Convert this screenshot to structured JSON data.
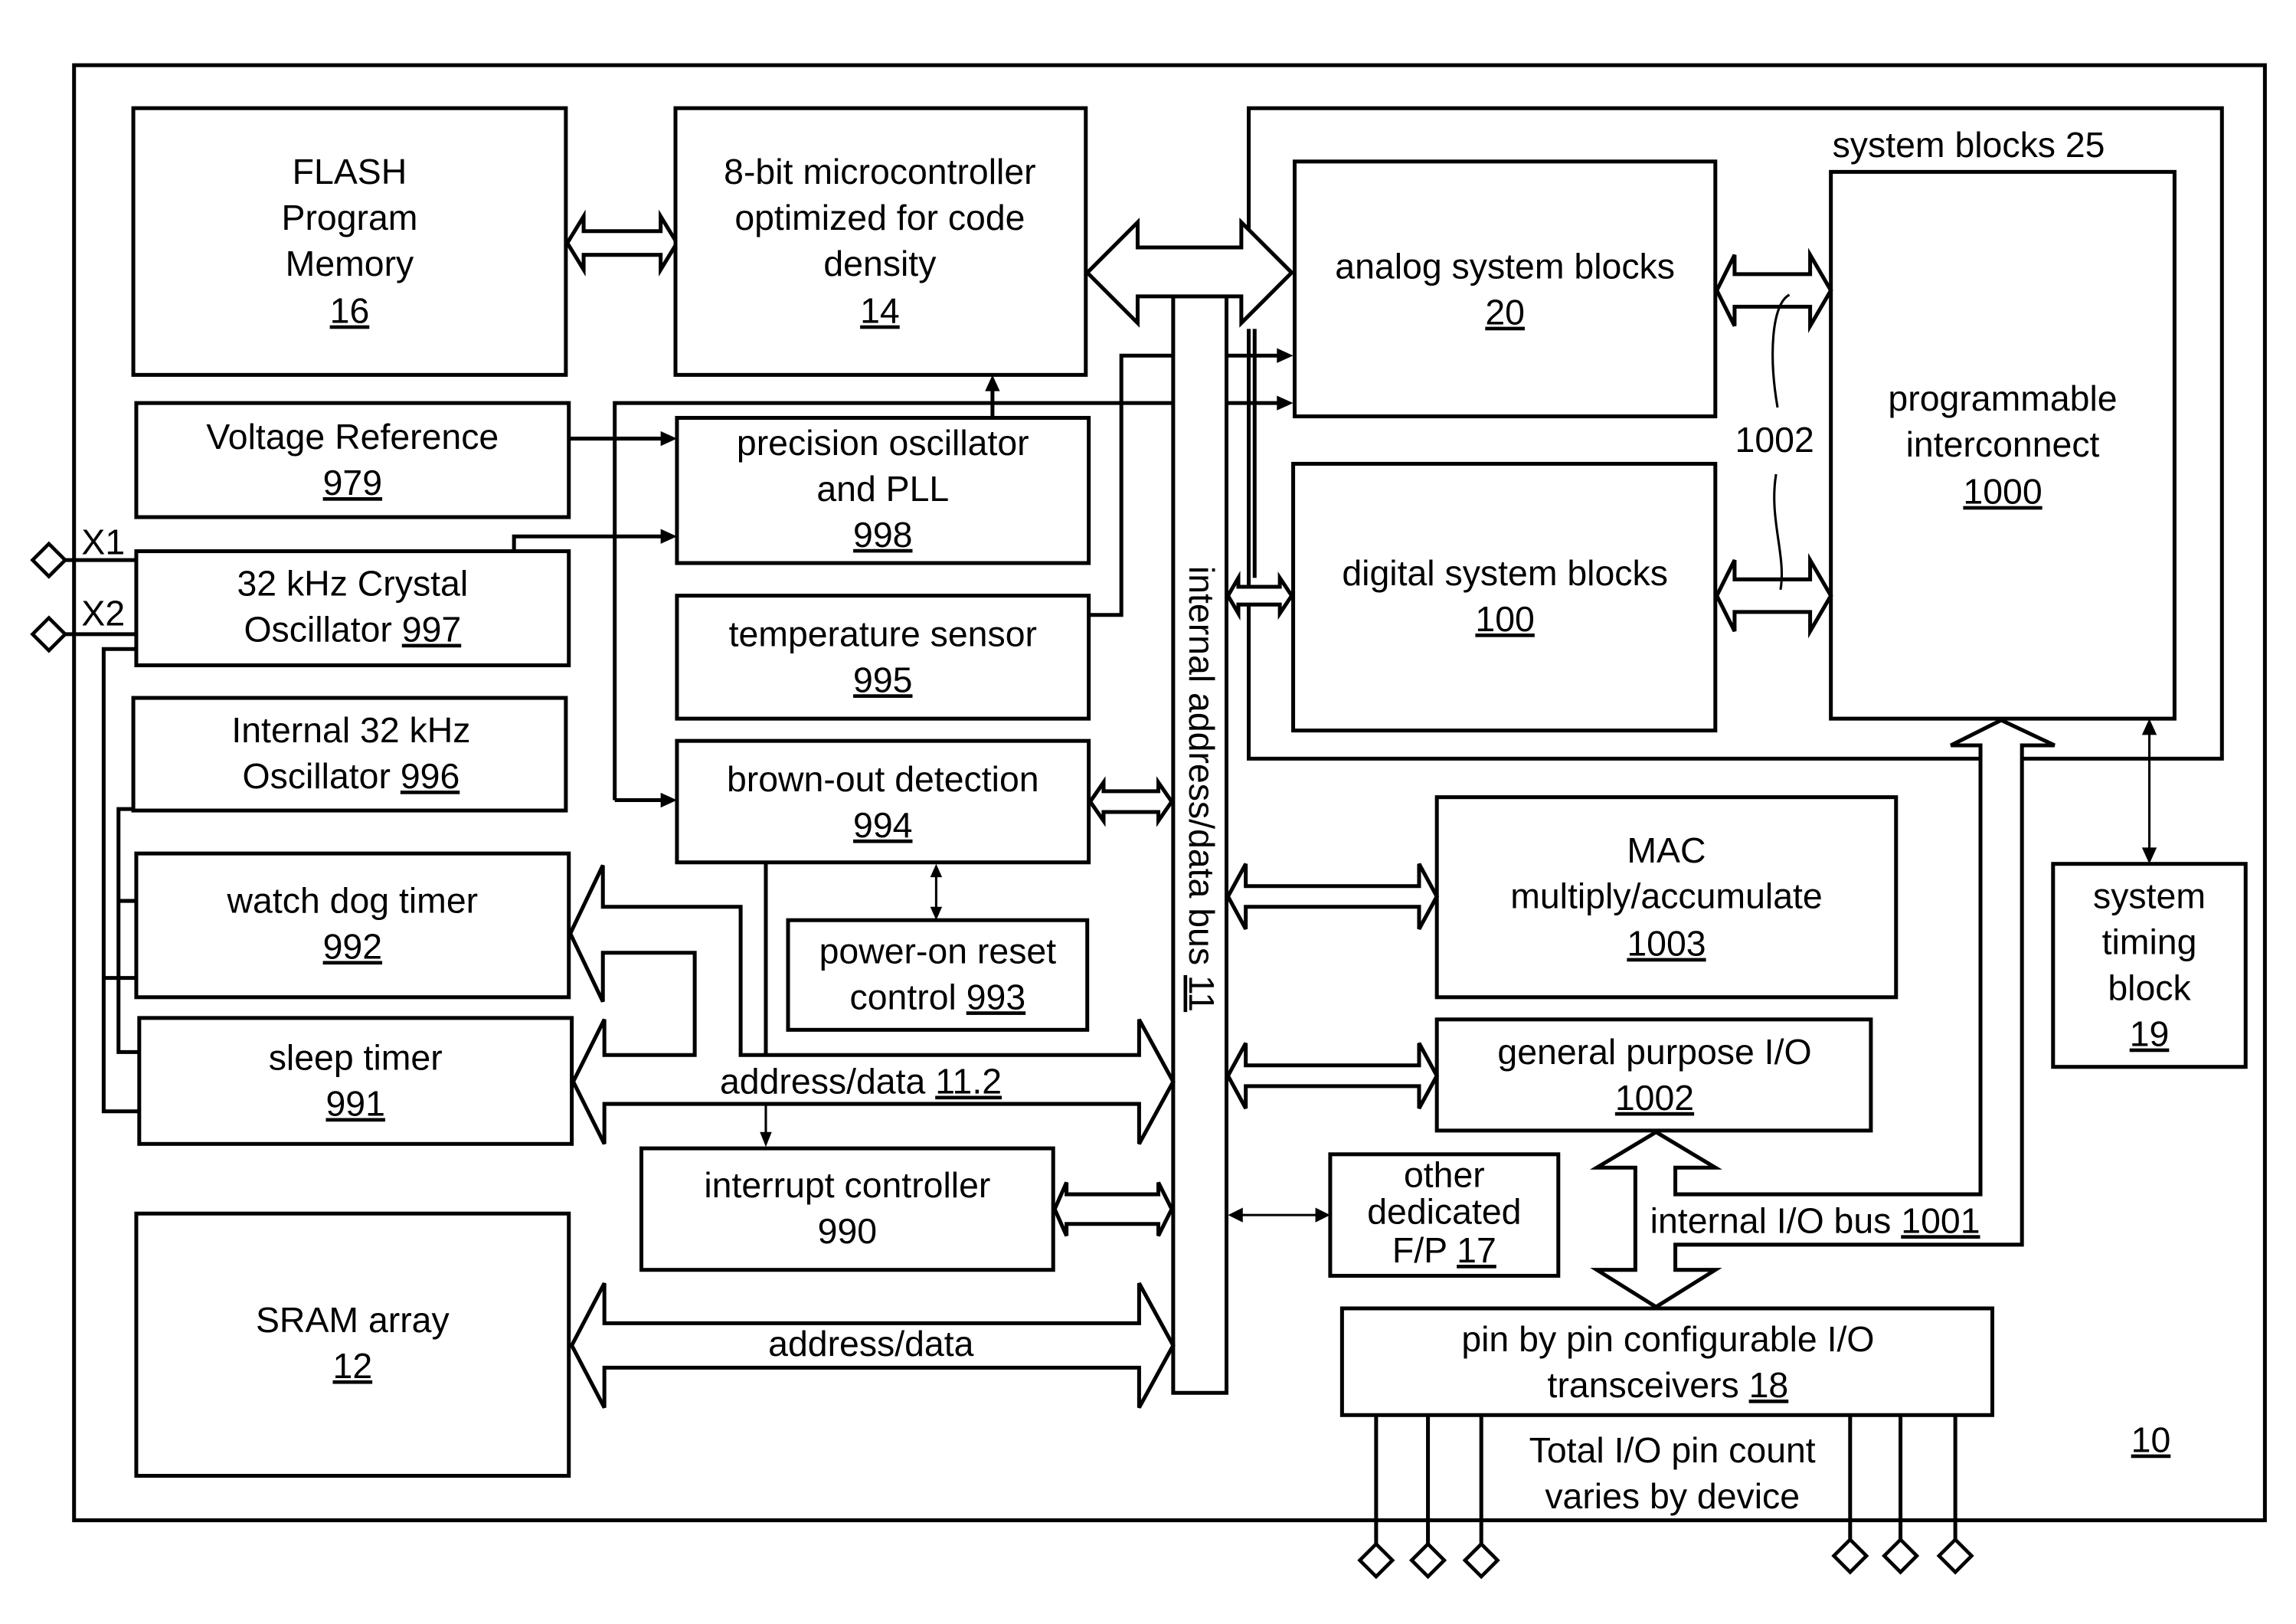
{
  "figure": {
    "ref": "10",
    "colors": {
      "line": "#000000",
      "background": "#ffffff"
    }
  },
  "blocks": {
    "flash": {
      "lines": [
        "FLASH",
        "Program",
        "Memory"
      ],
      "ref": "16"
    },
    "mcu": {
      "lines": [
        "8-bit microcontroller",
        "optimized for code",
        "density"
      ],
      "ref": "14"
    },
    "vref": {
      "line": "Voltage Reference",
      "ref": "979"
    },
    "pll": {
      "lines": [
        "precision oscillator",
        "and PLL"
      ],
      "ref": "998"
    },
    "xtal": {
      "line1": "32 kHz Crystal",
      "line2": "Oscillator ",
      "ref": "997"
    },
    "temp": {
      "line": "temperature sensor",
      "ref": "995"
    },
    "intosc": {
      "line1": "Internal 32 kHz",
      "line2": "Oscillator ",
      "ref": "996"
    },
    "bod": {
      "line": "brown-out detection",
      "ref": "994"
    },
    "wdt": {
      "line": "watch dog timer",
      "ref": "992"
    },
    "por": {
      "line1": "power-on reset",
      "line2": "control ",
      "ref": "993"
    },
    "sleep": {
      "line": "sleep timer",
      "ref": "991"
    },
    "irq": {
      "line": "interrupt controller",
      "ref": "990"
    },
    "sram": {
      "line": "SRAM array",
      "ref": "12"
    },
    "analog": {
      "line": "analog system blocks",
      "ref": "20"
    },
    "digital": {
      "line": "digital system blocks",
      "ref": "100"
    },
    "interconnect": {
      "lines": [
        "programmable",
        "interconnect"
      ],
      "ref": "1000"
    },
    "sysblocks": {
      "label": "system blocks 25"
    },
    "mac": {
      "lines": [
        "MAC",
        "multiply/accumulate"
      ],
      "ref": "1003"
    },
    "gpio": {
      "line": "general purpose I/O",
      "ref": "1002"
    },
    "timing": {
      "lines": [
        "system",
        "timing",
        "block"
      ],
      "ref": "19"
    },
    "other": {
      "lines": [
        "other",
        "dedicated",
        "F/P "
      ],
      "ref": "17"
    },
    "pins": {
      "line1": "pin by pin configurable I/O",
      "line2": "transceivers ",
      "ref": "18"
    }
  },
  "labels": {
    "x1": "X1",
    "x2": "X2",
    "bus_main": "internal address/data bus ",
    "bus_main_ref": "11",
    "addr_data_112": "address/data ",
    "addr_data_112_ref": "11.2",
    "addr_data_sram": "address/data",
    "interconnect_link_ref": "1002",
    "io_bus": "internal I/O bus ",
    "io_bus_ref": "1001",
    "pin_count_1": "Total I/O pin count",
    "pin_count_2": "varies by device"
  }
}
